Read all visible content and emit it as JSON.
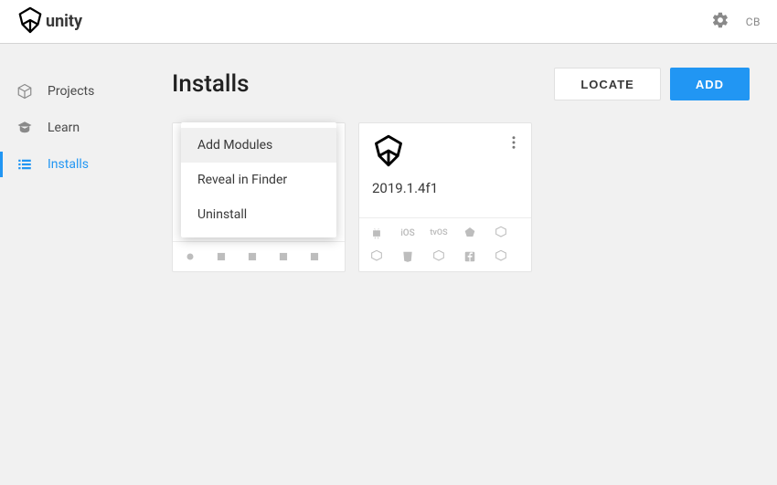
{
  "header": {
    "brand": "unity",
    "user_initials": "CB"
  },
  "sidebar": {
    "items": [
      {
        "label": "Projects"
      },
      {
        "label": "Learn"
      },
      {
        "label": "Installs"
      }
    ]
  },
  "page": {
    "title": "Installs",
    "locate_label": "LOCATE",
    "add_label": "ADD"
  },
  "context_menu": {
    "items": [
      {
        "label": "Add Modules"
      },
      {
        "label": "Reveal in Finder"
      },
      {
        "label": "Uninstall"
      }
    ]
  },
  "installs": [
    {
      "version": "2019.1.4f1",
      "platforms": [
        "android",
        "ios",
        "tvos",
        "lumin",
        "webgl",
        "xbox",
        "html5",
        "ps4",
        "facebook",
        "switch"
      ]
    }
  ]
}
